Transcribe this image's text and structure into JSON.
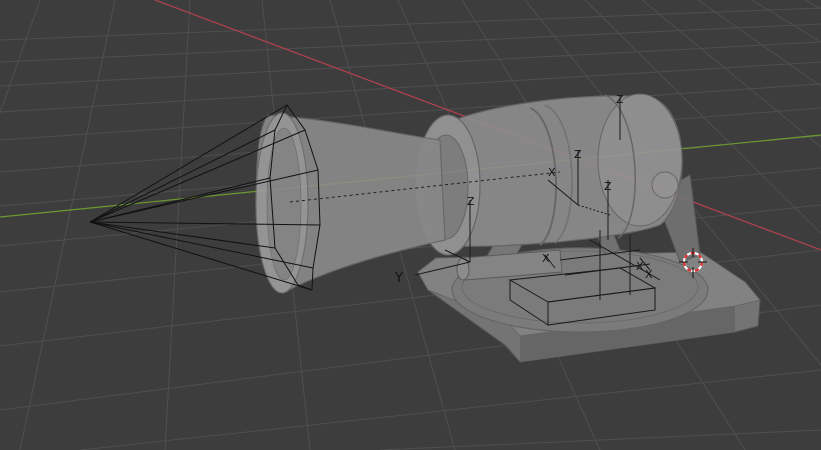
{
  "viewport": {
    "background": "#3d3d3d",
    "grid_color": "#4d4d4d",
    "x_axis_color": "#c24a55",
    "y_axis_color": "#6f9a31"
  },
  "objects": {
    "spotlight_cone": {
      "icon": "spotlight-cone",
      "color": "#111111"
    },
    "searchlight_model": {
      "icon": "searchlight-mesh",
      "color": "#8a8a8a",
      "display": "x-ray"
    },
    "empty_axes": {
      "color": "#1a1a1a"
    }
  },
  "labels": {
    "empty_z_1": "Z",
    "empty_z_2": "Z",
    "empty_z_3": "Z",
    "empty_z_4": "Z",
    "empty_y_1": "Y",
    "empty_x_1": "X",
    "empty_x_2": "X",
    "empty_x_3": "X",
    "empty_x_4": "X"
  },
  "cursor_3d": {
    "icon": "3d-cursor",
    "colors": [
      "#e03030",
      "#ffffff"
    ]
  }
}
